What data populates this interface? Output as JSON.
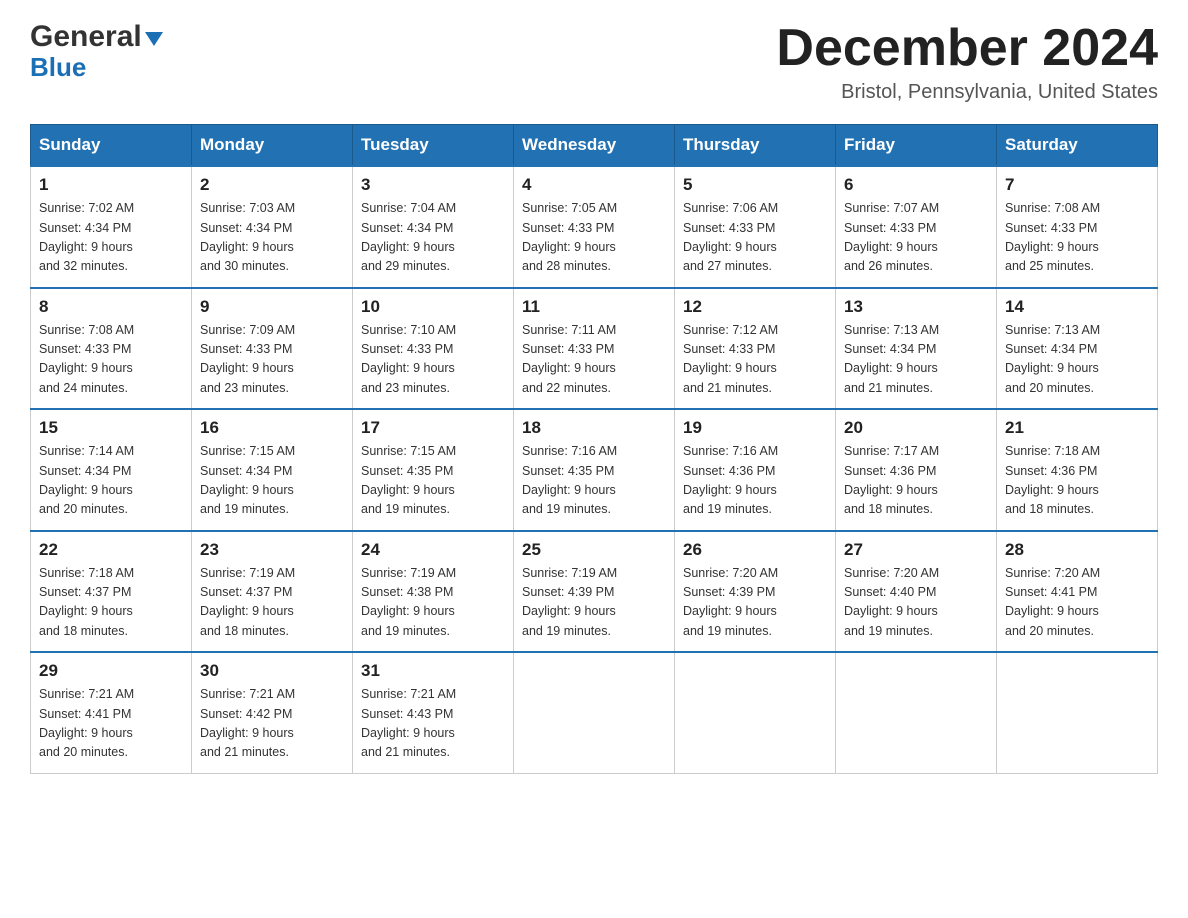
{
  "logo": {
    "line1": "General",
    "triangle_indicator": "▶",
    "line2": "Blue"
  },
  "title": {
    "month_year": "December 2024",
    "location": "Bristol, Pennsylvania, United States"
  },
  "days_of_week": [
    "Sunday",
    "Monday",
    "Tuesday",
    "Wednesday",
    "Thursday",
    "Friday",
    "Saturday"
  ],
  "weeks": [
    [
      {
        "day": "1",
        "sunrise": "7:02 AM",
        "sunset": "4:34 PM",
        "daylight": "9 hours and 32 minutes."
      },
      {
        "day": "2",
        "sunrise": "7:03 AM",
        "sunset": "4:34 PM",
        "daylight": "9 hours and 30 minutes."
      },
      {
        "day": "3",
        "sunrise": "7:04 AM",
        "sunset": "4:34 PM",
        "daylight": "9 hours and 29 minutes."
      },
      {
        "day": "4",
        "sunrise": "7:05 AM",
        "sunset": "4:33 PM",
        "daylight": "9 hours and 28 minutes."
      },
      {
        "day": "5",
        "sunrise": "7:06 AM",
        "sunset": "4:33 PM",
        "daylight": "9 hours and 27 minutes."
      },
      {
        "day": "6",
        "sunrise": "7:07 AM",
        "sunset": "4:33 PM",
        "daylight": "9 hours and 26 minutes."
      },
      {
        "day": "7",
        "sunrise": "7:08 AM",
        "sunset": "4:33 PM",
        "daylight": "9 hours and 25 minutes."
      }
    ],
    [
      {
        "day": "8",
        "sunrise": "7:08 AM",
        "sunset": "4:33 PM",
        "daylight": "9 hours and 24 minutes."
      },
      {
        "day": "9",
        "sunrise": "7:09 AM",
        "sunset": "4:33 PM",
        "daylight": "9 hours and 23 minutes."
      },
      {
        "day": "10",
        "sunrise": "7:10 AM",
        "sunset": "4:33 PM",
        "daylight": "9 hours and 23 minutes."
      },
      {
        "day": "11",
        "sunrise": "7:11 AM",
        "sunset": "4:33 PM",
        "daylight": "9 hours and 22 minutes."
      },
      {
        "day": "12",
        "sunrise": "7:12 AM",
        "sunset": "4:33 PM",
        "daylight": "9 hours and 21 minutes."
      },
      {
        "day": "13",
        "sunrise": "7:13 AM",
        "sunset": "4:34 PM",
        "daylight": "9 hours and 21 minutes."
      },
      {
        "day": "14",
        "sunrise": "7:13 AM",
        "sunset": "4:34 PM",
        "daylight": "9 hours and 20 minutes."
      }
    ],
    [
      {
        "day": "15",
        "sunrise": "7:14 AM",
        "sunset": "4:34 PM",
        "daylight": "9 hours and 20 minutes."
      },
      {
        "day": "16",
        "sunrise": "7:15 AM",
        "sunset": "4:34 PM",
        "daylight": "9 hours and 19 minutes."
      },
      {
        "day": "17",
        "sunrise": "7:15 AM",
        "sunset": "4:35 PM",
        "daylight": "9 hours and 19 minutes."
      },
      {
        "day": "18",
        "sunrise": "7:16 AM",
        "sunset": "4:35 PM",
        "daylight": "9 hours and 19 minutes."
      },
      {
        "day": "19",
        "sunrise": "7:16 AM",
        "sunset": "4:36 PM",
        "daylight": "9 hours and 19 minutes."
      },
      {
        "day": "20",
        "sunrise": "7:17 AM",
        "sunset": "4:36 PM",
        "daylight": "9 hours and 18 minutes."
      },
      {
        "day": "21",
        "sunrise": "7:18 AM",
        "sunset": "4:36 PM",
        "daylight": "9 hours and 18 minutes."
      }
    ],
    [
      {
        "day": "22",
        "sunrise": "7:18 AM",
        "sunset": "4:37 PM",
        "daylight": "9 hours and 18 minutes."
      },
      {
        "day": "23",
        "sunrise": "7:19 AM",
        "sunset": "4:37 PM",
        "daylight": "9 hours and 18 minutes."
      },
      {
        "day": "24",
        "sunrise": "7:19 AM",
        "sunset": "4:38 PM",
        "daylight": "9 hours and 19 minutes."
      },
      {
        "day": "25",
        "sunrise": "7:19 AM",
        "sunset": "4:39 PM",
        "daylight": "9 hours and 19 minutes."
      },
      {
        "day": "26",
        "sunrise": "7:20 AM",
        "sunset": "4:39 PM",
        "daylight": "9 hours and 19 minutes."
      },
      {
        "day": "27",
        "sunrise": "7:20 AM",
        "sunset": "4:40 PM",
        "daylight": "9 hours and 19 minutes."
      },
      {
        "day": "28",
        "sunrise": "7:20 AM",
        "sunset": "4:41 PM",
        "daylight": "9 hours and 20 minutes."
      }
    ],
    [
      {
        "day": "29",
        "sunrise": "7:21 AM",
        "sunset": "4:41 PM",
        "daylight": "9 hours and 20 minutes."
      },
      {
        "day": "30",
        "sunrise": "7:21 AM",
        "sunset": "4:42 PM",
        "daylight": "9 hours and 21 minutes."
      },
      {
        "day": "31",
        "sunrise": "7:21 AM",
        "sunset": "4:43 PM",
        "daylight": "9 hours and 21 minutes."
      },
      null,
      null,
      null,
      null
    ]
  ],
  "labels": {
    "sunrise_prefix": "Sunrise: ",
    "sunset_prefix": "Sunset: ",
    "daylight_prefix": "Daylight: "
  }
}
